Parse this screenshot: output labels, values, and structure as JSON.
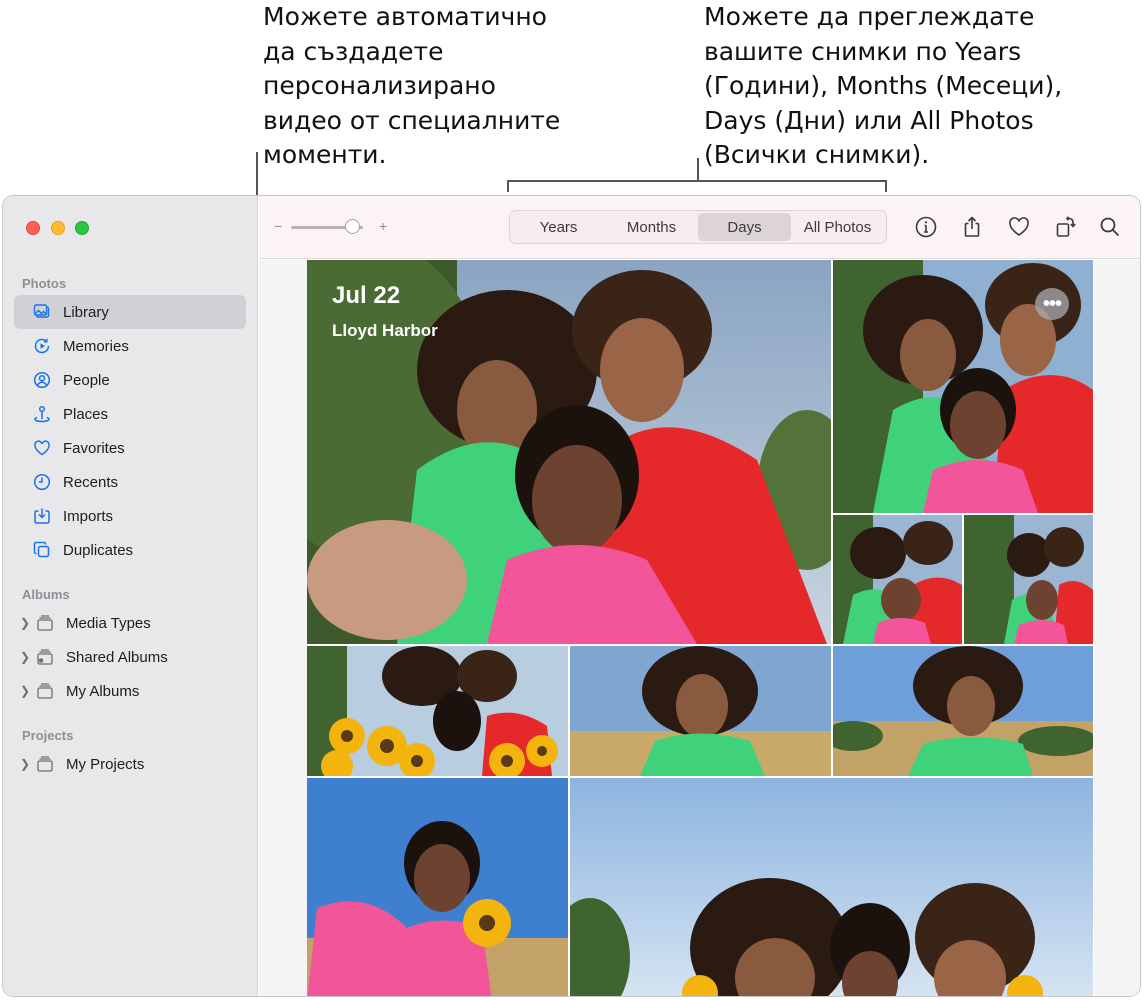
{
  "callouts": {
    "left": [
      "Можете автоматично",
      "да създадете",
      "персонализирано",
      "видео от специалните",
      "моменти."
    ],
    "right": [
      "Можете да преглеждате",
      "вашите снимки по Years",
      "(Години), Months (Месеци),",
      "Days (Дни) или All Photos",
      "(Всички снимки)."
    ]
  },
  "sidebar": {
    "photos_header": "Photos",
    "photos_items": [
      {
        "label": "Library",
        "icon": "library-icon",
        "selected": true
      },
      {
        "label": "Memories",
        "icon": "memories-icon"
      },
      {
        "label": "People",
        "icon": "people-icon"
      },
      {
        "label": "Places",
        "icon": "places-icon"
      },
      {
        "label": "Favorites",
        "icon": "heart-icon"
      },
      {
        "label": "Recents",
        "icon": "clock-icon"
      },
      {
        "label": "Imports",
        "icon": "import-icon"
      },
      {
        "label": "Duplicates",
        "icon": "duplicates-icon"
      }
    ],
    "albums_header": "Albums",
    "albums_items": [
      {
        "label": "Media Types",
        "icon": "folder-stack-icon"
      },
      {
        "label": "Shared Albums",
        "icon": "shared-folder-icon"
      },
      {
        "label": "My Albums",
        "icon": "folder-stack-icon"
      }
    ],
    "projects_header": "Projects",
    "projects_items": [
      {
        "label": "My Projects",
        "icon": "folder-stack-icon"
      }
    ]
  },
  "toolbar": {
    "zoom_minus": "−",
    "zoom_plus": "+",
    "zoom_level": 0.85,
    "tabs": [
      "Years",
      "Months",
      "Days",
      "All Photos"
    ],
    "selected_tab": "Days",
    "icons": [
      "info-icon",
      "share-icon",
      "heart-icon",
      "rotate-icon",
      "search-icon"
    ]
  },
  "main": {
    "date": "Jul 22",
    "place": "Lloyd Harbor",
    "more_label": "•••"
  },
  "colors": {
    "accent": "#1a73e8",
    "toolbar_bg": "#fbf3f4",
    "sidebar_bg": "#e8e8ea"
  }
}
